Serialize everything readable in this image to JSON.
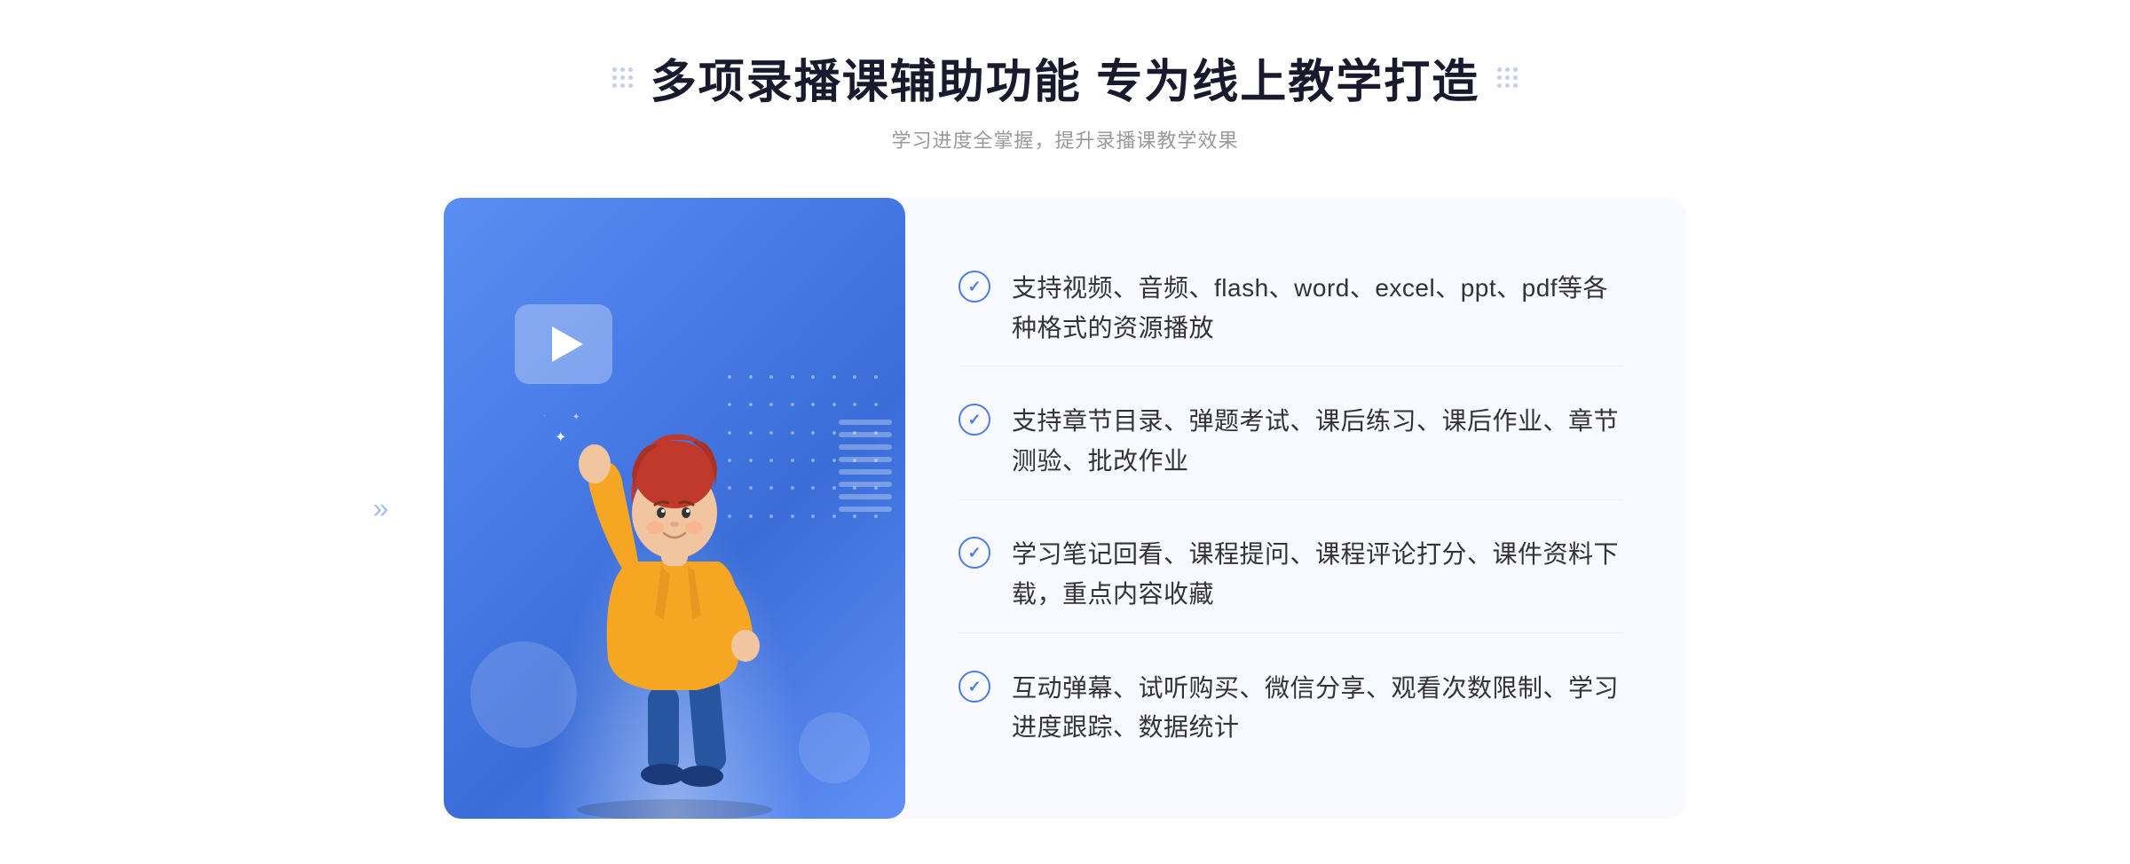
{
  "header": {
    "title": "多项录播课辅助功能 专为线上教学打造",
    "subtitle": "学习进度全掌握，提升录播课教学效果"
  },
  "decorations": {
    "dots_left": ":::",
    "dots_right": ":::"
  },
  "features": [
    {
      "id": 1,
      "text": "支持视频、音频、flash、word、excel、ppt、pdf等各种格式的资源播放"
    },
    {
      "id": 2,
      "text": "支持章节目录、弹题考试、课后练习、课后作业、章节测验、批改作业"
    },
    {
      "id": 3,
      "text": "学习笔记回看、课程提问、课程评论打分、课件资料下载，重点内容收藏"
    },
    {
      "id": 4,
      "text": "互动弹幕、试听购买、微信分享、观看次数限制、学习进度跟踪、数据统计"
    }
  ],
  "illustration": {
    "play_button": "▶",
    "left_arrows": "«"
  },
  "colors": {
    "brand_blue": "#4a7de8",
    "bg_light": "#f8faff",
    "text_dark": "#1a1a2e",
    "text_gray": "#999999"
  }
}
